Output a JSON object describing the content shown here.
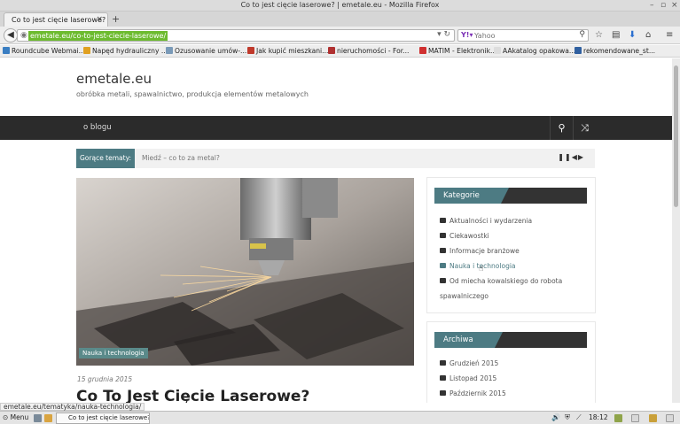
{
  "window": {
    "title": "Co to jest cięcie laserowe? | emetale.eu - Mozilla Firefox"
  },
  "tab": {
    "label": "Co to jest cięcie laserowe?",
    "close": "×",
    "new": "+"
  },
  "navbar": {
    "url": "emetale.eu/co-to-jest-ciecie-laserowe/",
    "search_placeholder": "Yahoo"
  },
  "bookmarks": [
    {
      "label": "Roundcube Webmai...",
      "color": "#3a7ec2"
    },
    {
      "label": "Napęd hydrauliczny ...",
      "color": "#e0a020"
    },
    {
      "label": "Ozusowanie umów-...",
      "color": "#7a9ab8"
    },
    {
      "label": "Jak kupić mieszkani...",
      "color": "#c0392b"
    },
    {
      "label": "nieruchomości - For...",
      "color": "#b03030"
    },
    {
      "label": "MATIM - Elektronik...",
      "color": "#d03030"
    },
    {
      "label": "AAkatalog opakowa...",
      "color": "#dddddd"
    },
    {
      "label": "rekomendowane_st...",
      "color": "#3060a0"
    }
  ],
  "site": {
    "title": "emetale.eu",
    "description": "obróbka metali, spawalnictwo, produkcja elementów metalowych"
  },
  "menu": {
    "item": "o blogu"
  },
  "ticker": {
    "label": "Gorące tematy:",
    "item": "Miedź – co to za metal?",
    "controls": "❚❚◀▶"
  },
  "post": {
    "category": "Nauka i technologia",
    "date": "15 grudnia 2015",
    "title": "Co To Jest Cięcie Laserowe?"
  },
  "widgets": {
    "categories_title": "Kategorie",
    "categories": [
      "Aktualności i wydarzenia",
      "Ciekawostki",
      "Informacje branżowe",
      "Nauka i technologia",
      "Od miecha kowalskiego do robota"
    ],
    "categories_cont": "spawalniczego",
    "archive_title": "Archiwa",
    "archive": [
      "Grudzień 2015",
      "Listopad 2015",
      "Październik 2015"
    ]
  },
  "status": {
    "hover_url": "emetale.eu/tematyka/nauka-technologia/"
  },
  "taskbar": {
    "menu": "Menu",
    "task": "Co to jest cięcie laserowe?...",
    "clock": "18:12"
  },
  "colors": {
    "accent": "#4d7b83",
    "nav_bg": "#2b2b2b"
  }
}
